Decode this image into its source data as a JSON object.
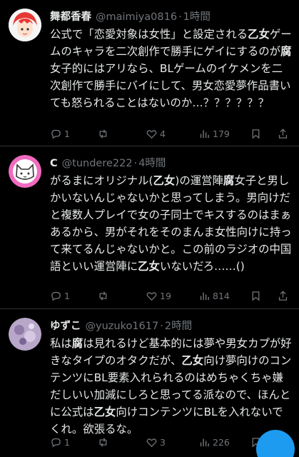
{
  "tweets": [
    {
      "name": "舞都香春",
      "handle": "@maimiya0816",
      "time": "1時間",
      "body_segments": [
        {
          "t": "公式で「恋愛対象は女性」と設定される"
        },
        {
          "t": "乙女",
          "b": true
        },
        {
          "t": "ゲームのキャラを二次創作で勝手にゲイにするのが"
        },
        {
          "t": "腐",
          "b": true
        },
        {
          "t": "女子的にはアリなら、BLゲームのイケメンを二次創作で勝手にバイにして、男女恋愛夢作品書いても怒られることはないのか…？？？？？？"
        }
      ],
      "replies": "1",
      "retweets": "",
      "likes": "4",
      "views": "179"
    },
    {
      "name": "C",
      "handle": "@tundere222",
      "time": "4時間",
      "body_segments": [
        {
          "t": "がるまにオリジナル("
        },
        {
          "t": "乙女",
          "b": true
        },
        {
          "t": ")の運営陣"
        },
        {
          "t": "腐",
          "b": true
        },
        {
          "t": "女子と男しかいないんじゃないかと思ってしまう。男向けだと複数人プレイで女の子同士でキスするのはまぁあるから、男がそれをそのまんま女性向けに持って来てるんじゃないかと。この前のラジオの中国語といい運営陣に"
        },
        {
          "t": "乙女",
          "b": true
        },
        {
          "t": "いないだろ……()"
        }
      ],
      "replies": "1",
      "retweets": "",
      "likes": "19",
      "views": "814"
    },
    {
      "name": "ゆずこ",
      "handle": "@yuzuko1617",
      "time": "2時間",
      "body_segments": [
        {
          "t": "私は"
        },
        {
          "t": "腐",
          "b": true
        },
        {
          "t": "は見れるけど基本的には夢や男女カプが好きなタイプのオタクだが、"
        },
        {
          "t": "乙女",
          "b": true
        },
        {
          "t": "向け夢向けのコンテンツにBL要素入れられるのはめちゃくちゃ嫌だしいい加減にしろと思ってる派なので、ほんとに公式は"
        },
        {
          "t": "乙女",
          "b": true
        },
        {
          "t": "向けコンテンツにBLを入れないでくれ。欲張るな。"
        }
      ],
      "replies": "1",
      "retweets": "",
      "likes": "3",
      "views": "226"
    }
  ],
  "icons": {
    "reply": "reply-icon",
    "retweet": "retweet-icon",
    "like": "like-icon",
    "views": "views-icon",
    "bookmark": "bookmark-icon",
    "share": "share-icon",
    "more": "more-icon"
  },
  "colors": {
    "background": "#000000",
    "text": "#e7e9ea",
    "muted": "#71767b",
    "divider": "#2f3336",
    "accent": "#1d9bf0"
  }
}
